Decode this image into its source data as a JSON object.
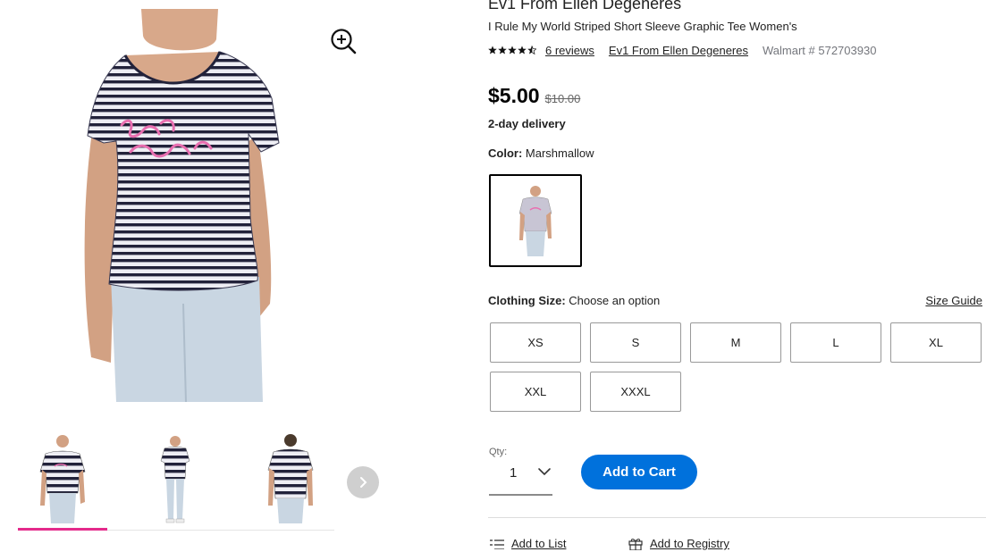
{
  "product": {
    "brand_title": "Ev1 From Ellen Degeneres",
    "name": "I Rule My World Striped Short Sleeve Graphic Tee Women's",
    "rating": 4.5,
    "reviews_label": "6 reviews",
    "brand_link": "Ev1 From Ellen Degeneres",
    "walmart_number": "Walmart # 572703930"
  },
  "price": {
    "current": "$5.00",
    "was": "$10.00"
  },
  "delivery": "2-day delivery",
  "color": {
    "label": "Color:",
    "value": "Marshmallow"
  },
  "size": {
    "label": "Clothing Size:",
    "value": "Choose an option",
    "guide_label": "Size Guide",
    "options": [
      "XS",
      "S",
      "M",
      "L",
      "XL",
      "XXL",
      "XXXL"
    ]
  },
  "quantity": {
    "label": "Qty:",
    "value": "1"
  },
  "actions": {
    "add_to_cart": "Add to Cart",
    "add_to_list": "Add to List",
    "add_to_registry": "Add to Registry"
  },
  "colors": {
    "accent_blue": "#0071dc",
    "thumb_indicator": "#e42a8b"
  }
}
